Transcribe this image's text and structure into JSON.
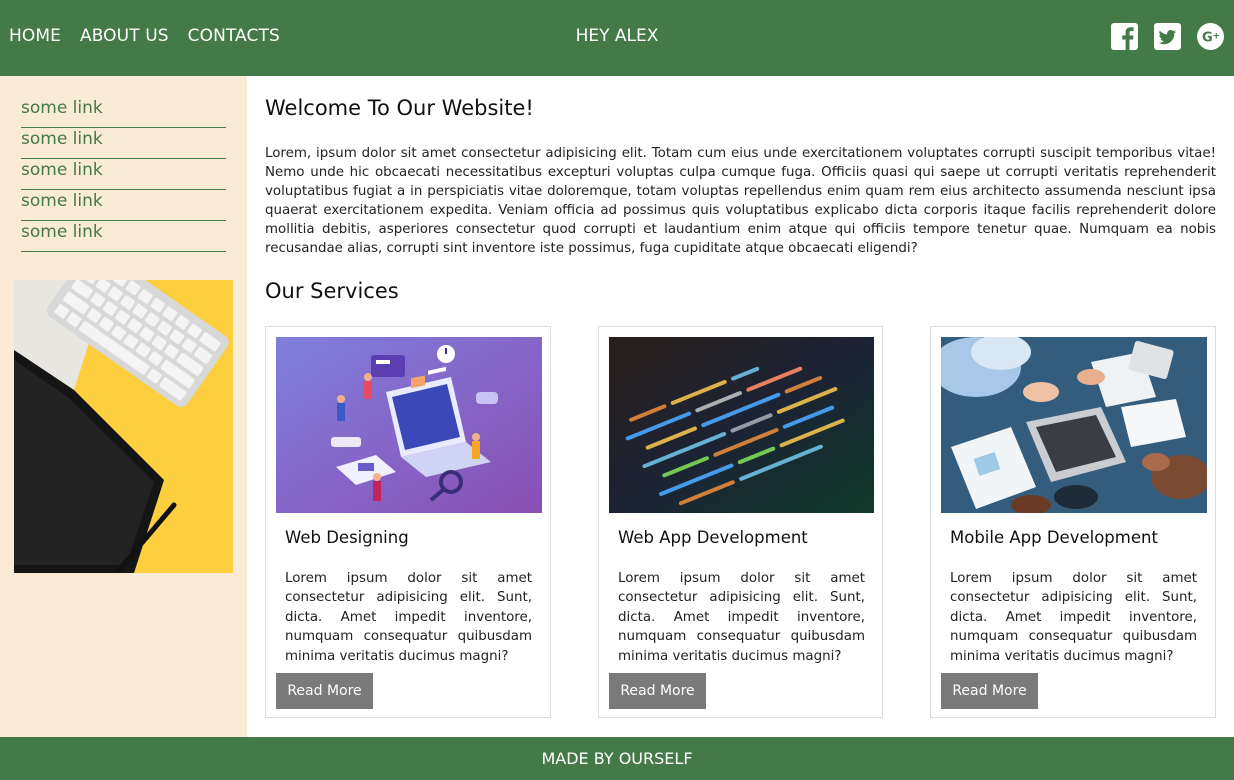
{
  "header": {
    "nav": [
      "HOME",
      "ABOUT US",
      "CONTACTS"
    ],
    "greeting": "HEY ALEX",
    "social_icons": [
      "facebook-icon",
      "twitter-icon",
      "google-plus-icon"
    ],
    "background_color": "#447a47"
  },
  "sidebar": {
    "links": [
      "some link",
      "some link",
      "some link",
      "some link",
      "some link"
    ],
    "image": "keyboard-tablet-photo",
    "background_color": "#faebd7",
    "link_color": "#447a47"
  },
  "main": {
    "welcome_title": "Welcome To Our Website!",
    "intro": "Lorem, ipsum dolor sit amet consectetur adipisicing elit. Totam cum eius unde exercitationem voluptates corrupti suscipit temporibus vitae! Nemo unde hic obcaecati necessitatibus excepturi voluptas culpa cumque fuga. Officiis quasi qui saepe ut corrupti veritatis reprehenderit voluptatibus fugiat a in perspiciatis vitae doloremque, totam voluptas repellendus enim quam rem eius architecto assumenda nesciunt ipsa quaerat exercitationem expedita. Veniam officia ad possimus quis voluptatibus explicabo dicta corporis itaque facilis reprehenderit dolore mollitia debitis, asperiores consectetur quod corrupti et laudantium enim atque qui officiis tempore tenetur quae. Numquam ea nobis recusandae alias, corrupti sint inventore iste possimus, fuga cupiditate atque obcaecati eligendi?",
    "services_title": "Our Services",
    "services": [
      {
        "title": "Web Designing",
        "text": "Lorem ipsum dolor sit amet consectetur adipisicing elit. Sunt, dicta. Amet impedit inventore, numquam consequatur quibusdam minima veritatis ducimus magni?",
        "button": "Read More",
        "image": "web-design-illustration"
      },
      {
        "title": "Web App Development",
        "text": "Lorem ipsum dolor sit amet consectetur adipisicing elit. Sunt, dicta. Amet impedit inventore, numquam consequatur quibusdam minima veritatis ducimus magni?",
        "button": "Read More",
        "image": "code-screen-photo"
      },
      {
        "title": "Mobile App Development",
        "text": "Lorem ipsum dolor sit amet consectetur adipisicing elit. Sunt, dicta. Amet impedit inventore, numquam consequatur quibusdam minima veritatis ducimus magni?",
        "button": "Read More",
        "image": "business-meeting-photo"
      }
    ]
  },
  "footer": {
    "text": "MADE BY OURSELF"
  }
}
